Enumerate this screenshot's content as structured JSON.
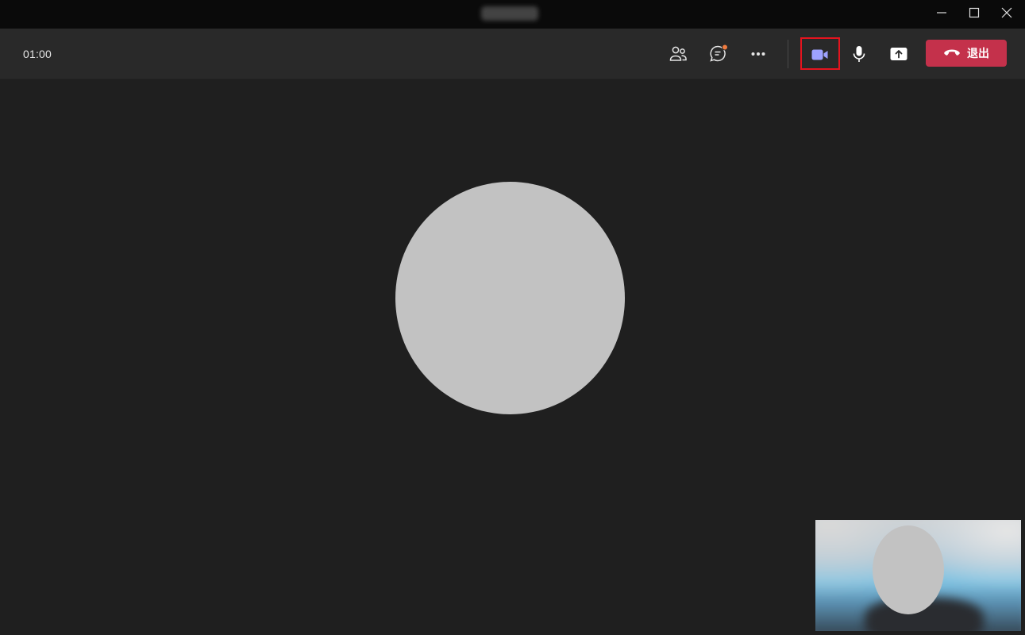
{
  "titlebar": {
    "controls": [
      {
        "name": "minimize",
        "icon": "minimize-icon"
      },
      {
        "name": "maximize",
        "icon": "maximize-icon"
      },
      {
        "name": "close",
        "icon": "close-icon"
      }
    ]
  },
  "toolbar": {
    "timer": "01:00",
    "buttons": [
      {
        "name": "participants",
        "icon": "people-icon"
      },
      {
        "name": "chat",
        "icon": "chat-icon",
        "notification": true
      },
      {
        "name": "more",
        "icon": "more-icon"
      },
      {
        "name": "camera",
        "icon": "camera-icon",
        "highlighted": true
      },
      {
        "name": "microphone",
        "icon": "microphone-icon"
      },
      {
        "name": "share",
        "icon": "share-screen-icon"
      }
    ],
    "leave_label": "退出"
  },
  "colors": {
    "titlebar_bg": "#0a0a0a",
    "toolbar_bg": "#292929",
    "stage_bg": "#1f1f1f",
    "avatar": "#c2c2c2",
    "camera_accent": "#9ea2ff",
    "leave_button": "#c4314b",
    "highlight_box": "#e5141e",
    "notification_dot": "#f07b3f"
  }
}
